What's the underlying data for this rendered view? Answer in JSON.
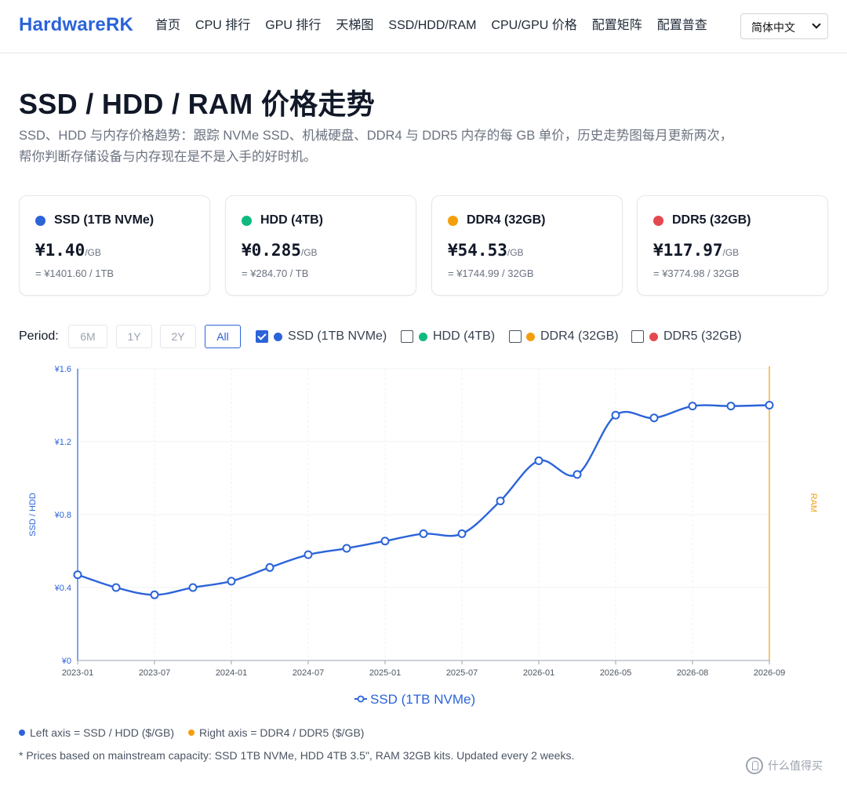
{
  "header": {
    "brand": "HardwareRK",
    "nav": [
      "首页",
      "CPU 排行",
      "GPU 排行",
      "天梯图",
      "SSD/HDD/RAM",
      "CPU/GPU 价格",
      "配置矩阵",
      "配置普查"
    ],
    "language": "简体中文"
  },
  "page": {
    "title": "SSD / HDD / RAM 价格走势",
    "desc_line1": "SSD、HDD 与内存价格趋势：跟踪 NVMe SSD、机械硬盘、DDR4 与 DDR5 内存的每 GB 单价，历史走势图每月更新两次，",
    "desc_line2": "帮你判断存储设备与内存现在是不是入手的好时机。"
  },
  "cards": [
    {
      "name": "SSD (1TB NVMe)",
      "price": "¥1.40",
      "unit": "/GB",
      "sub": "= ¥1401.60 / 1TB",
      "color": "#2b63d9"
    },
    {
      "name": "HDD (4TB)",
      "price": "¥0.285",
      "unit": "/GB",
      "sub": "= ¥284.70 / TB",
      "color": "#10b981"
    },
    {
      "name": "DDR4 (32GB)",
      "price": "¥54.53",
      "unit": "/GB",
      "sub": "= ¥1744.99 / 32GB",
      "color": "#f59e0b"
    },
    {
      "name": "DDR5 (32GB)",
      "price": "¥117.97",
      "unit": "/GB",
      "sub": "= ¥3774.98 / 32GB",
      "color": "#e5484d"
    }
  ],
  "controls": {
    "period_label": "Period:",
    "periods": [
      "6M",
      "1Y",
      "2Y",
      "All"
    ],
    "active_period": "All",
    "series_toggles": [
      {
        "label": "SSD (1TB NVMe)",
        "checked": true,
        "color": "#2b63d9"
      },
      {
        "label": "HDD (4TB)",
        "checked": false,
        "color": "#10b981"
      },
      {
        "label": "DDR4 (32GB)",
        "checked": false,
        "color": "#f59e0b"
      },
      {
        "label": "DDR5 (32GB)",
        "checked": false,
        "color": "#e5484d"
      }
    ]
  },
  "chart_data": {
    "type": "line",
    "x": [
      "2023-01",
      "2023-04",
      "2023-07",
      "2023-10",
      "2024-01",
      "2024-04",
      "2024-07",
      "2024-10",
      "2025-01",
      "2025-04",
      "2025-07",
      "2025-10",
      "2026-01",
      "2026-03",
      "2026-05",
      "2026-06",
      "2026-08",
      "2026-09a",
      "2026-09"
    ],
    "x_ticks": [
      "2023-01",
      "2023-07",
      "2024-01",
      "2024-07",
      "2025-01",
      "2025-07",
      "2026-01",
      "2026-05",
      "2026-08",
      "2026-09"
    ],
    "series": [
      {
        "name": "SSD (1TB NVMe)",
        "color": "#2b63d9",
        "values": [
          0.47,
          0.4,
          0.36,
          0.4,
          0.435,
          0.51,
          0.58,
          0.615,
          0.655,
          0.695,
          0.695,
          0.875,
          1.095,
          1.02,
          1.345,
          1.33,
          1.395,
          1.395,
          1.4
        ]
      }
    ],
    "left_axis_label": "SSD / HDD",
    "right_axis_label": "RAM",
    "y_ticks": [
      "¥0",
      "¥0.4",
      "¥0.8",
      "¥1.2",
      "¥1.6"
    ],
    "ylim": [
      0,
      1.6
    ],
    "legend": "SSD (1TB NVMe)",
    "legend_position": "bottom",
    "grid": true
  },
  "notes": {
    "left_axis": "Left axis = SSD / HDD ($/GB)",
    "right_axis": "Right axis = DDR4 / DDR5 ($/GB)",
    "footnote": "* Prices based on mainstream capacity: SSD 1TB NVMe, HDD 4TB 3.5\", RAM 32GB kits. Updated every 2 weeks.",
    "left_color": "#2b63d9",
    "right_color": "#f59e0b"
  },
  "watermark": "什么值得买"
}
